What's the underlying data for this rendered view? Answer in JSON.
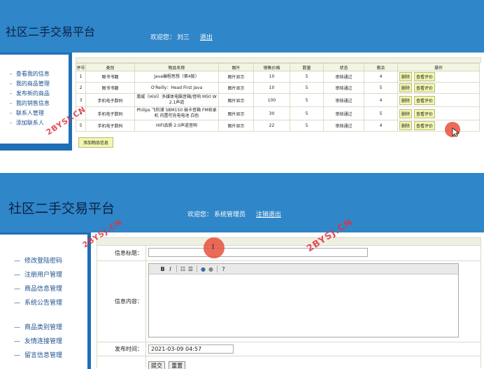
{
  "panel1": {
    "site_title": "社区二手交易平台",
    "welcome_prefix": "欢迎您：",
    "welcome_user": "刘三",
    "logout_label": "退出",
    "sidebar_items": [
      "查看我的信息",
      "我的商品管理",
      "发布新的商品",
      "我的销售信息",
      "联系人管理",
      "添加联系人"
    ],
    "table": {
      "columns": [
        "序号",
        "类别",
        "物品名称",
        "图片",
        "销售价格",
        "数量",
        "状态",
        "剩余",
        "操作"
      ],
      "rows": [
        {
          "no": "1",
          "category": "图书书籍",
          "name": "Java编程思想（第4版）",
          "image": "图片显示",
          "price": "10",
          "qty": "5",
          "status": "审核通过",
          "remain": "4"
        },
        {
          "no": "2",
          "category": "图书书籍",
          "name": "O'Reilly：Head First Java",
          "image": "图片显示",
          "price": "10",
          "qty": "5",
          "status": "审核通过",
          "remain": "5"
        },
        {
          "no": "3",
          "category": "手机电子数码",
          "name": "惠威（HiVi）多媒体电脑音箱/音响 M50 W 2.1声道",
          "image": "图片显示",
          "price": "100",
          "qty": "5",
          "status": "审核通过",
          "remain": "4"
        },
        {
          "no": "4",
          "category": "手机电子数码",
          "name": "Philips 飞利浦 SBM150 插卡音箱 FM收录机 内置可充电电池 白色",
          "image": "图片显示",
          "price": "30",
          "qty": "5",
          "status": "审核通过",
          "remain": "5"
        },
        {
          "no": "5",
          "category": "手机电子数码",
          "name": "HIFI品质 2.0声道音响",
          "image": "图片显示",
          "price": "22",
          "qty": "5",
          "status": "审核通过",
          "remain": "4"
        }
      ],
      "delete_label": "删除",
      "review_label": "查看评价"
    },
    "add_button": "添加物品信息",
    "watermark": "2BYSJ.CN"
  },
  "panel2": {
    "site_title": "社区二手交易平台",
    "welcome_prefix": "欢迎您：",
    "welcome_user": "系统管理员",
    "logout_label": "注销退出",
    "sidebar_group1": [
      "修改登陆密码",
      "注册用户管理",
      "商品信息管理",
      "系统公告管理"
    ],
    "sidebar_group2": [
      "商品类别管理",
      "友情连接管理",
      "留言信息管理"
    ],
    "form": {
      "title_label": "信息标题：",
      "title_value": "",
      "content_label": "信息内容：",
      "date_label": "发布时间：",
      "date_value": "2021-03-09 04:57",
      "submit_label": "提交",
      "reset_label": "重置"
    },
    "watermark1": "2BYSJ.CN",
    "watermark2": "2BYSJ.CN"
  },
  "colors": {
    "header": "#2f86c9",
    "sidebar_border": "#1f6fb7",
    "button": "#f2f7b0",
    "watermark": "#e0323f"
  }
}
